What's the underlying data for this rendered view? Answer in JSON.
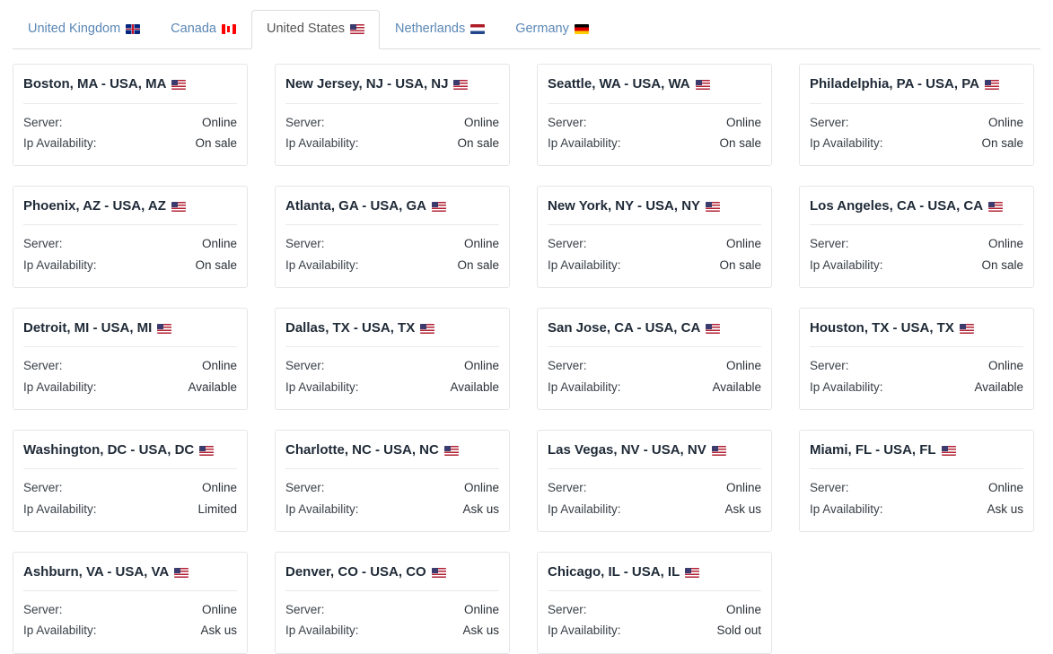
{
  "tabs": [
    {
      "label": "United Kingdom",
      "flag": "flag-gb",
      "flag_name": "flag-icon-uk",
      "active": false
    },
    {
      "label": "Canada",
      "flag": "flag-ca",
      "flag_name": "flag-icon-canada",
      "active": false
    },
    {
      "label": "United States",
      "flag": "flag-us",
      "flag_name": "flag-icon-usa",
      "active": true
    },
    {
      "label": "Netherlands",
      "flag": "flag-nl",
      "flag_name": "flag-icon-netherlands",
      "active": false
    },
    {
      "label": "Germany",
      "flag": "flag-de",
      "flag_name": "flag-icon-germany",
      "active": false
    }
  ],
  "labels": {
    "server": "Server:",
    "ip_availability": "Ip Availability:"
  },
  "cards": [
    {
      "title": "Boston, MA - USA, MA",
      "flag": "flag-us",
      "server": "Online",
      "ip_availability": "On sale"
    },
    {
      "title": "New Jersey, NJ - USA, NJ",
      "flag": "flag-us",
      "server": "Online",
      "ip_availability": "On sale"
    },
    {
      "title": "Seattle, WA - USA, WA",
      "flag": "flag-us",
      "server": "Online",
      "ip_availability": "On sale"
    },
    {
      "title": "Philadelphia, PA - USA, PA",
      "flag": "flag-us",
      "server": "Online",
      "ip_availability": "On sale"
    },
    {
      "title": "Phoenix, AZ - USA, AZ",
      "flag": "flag-us",
      "server": "Online",
      "ip_availability": "On sale"
    },
    {
      "title": "Atlanta, GA - USA, GA",
      "flag": "flag-us",
      "server": "Online",
      "ip_availability": "On sale"
    },
    {
      "title": "New York, NY - USA, NY",
      "flag": "flag-us",
      "server": "Online",
      "ip_availability": "On sale"
    },
    {
      "title": "Los Angeles, CA - USA, CA",
      "flag": "flag-us",
      "server": "Online",
      "ip_availability": "On sale"
    },
    {
      "title": "Detroit, MI - USA, MI",
      "flag": "flag-us",
      "server": "Online",
      "ip_availability": "Available"
    },
    {
      "title": "Dallas, TX - USA, TX",
      "flag": "flag-us",
      "server": "Online",
      "ip_availability": "Available"
    },
    {
      "title": "San Jose, CA - USA, CA",
      "flag": "flag-us",
      "server": "Online",
      "ip_availability": "Available"
    },
    {
      "title": "Houston, TX - USA, TX",
      "flag": "flag-us",
      "server": "Online",
      "ip_availability": "Available"
    },
    {
      "title": "Washington, DC - USA, DC",
      "flag": "flag-us",
      "server": "Online",
      "ip_availability": "Limited"
    },
    {
      "title": "Charlotte, NC - USA, NC",
      "flag": "flag-us",
      "server": "Online",
      "ip_availability": "Ask us"
    },
    {
      "title": "Las Vegas, NV - USA, NV",
      "flag": "flag-us",
      "server": "Online",
      "ip_availability": "Ask us"
    },
    {
      "title": "Miami, FL - USA, FL",
      "flag": "flag-us",
      "server": "Online",
      "ip_availability": "Ask us"
    },
    {
      "title": "Ashburn, VA - USA, VA",
      "flag": "flag-us",
      "server": "Online",
      "ip_availability": "Ask us"
    },
    {
      "title": "Denver, CO - USA, CO",
      "flag": "flag-us",
      "server": "Online",
      "ip_availability": "Ask us"
    },
    {
      "title": "Chicago, IL - USA, IL",
      "flag": "flag-us",
      "server": "Online",
      "ip_availability": "Sold out"
    }
  ],
  "colors": {
    "tab_link": "#5b87b5",
    "tab_active_text": "#555555",
    "card_border": "#e4e6e8",
    "title_text": "#1f2a37"
  }
}
